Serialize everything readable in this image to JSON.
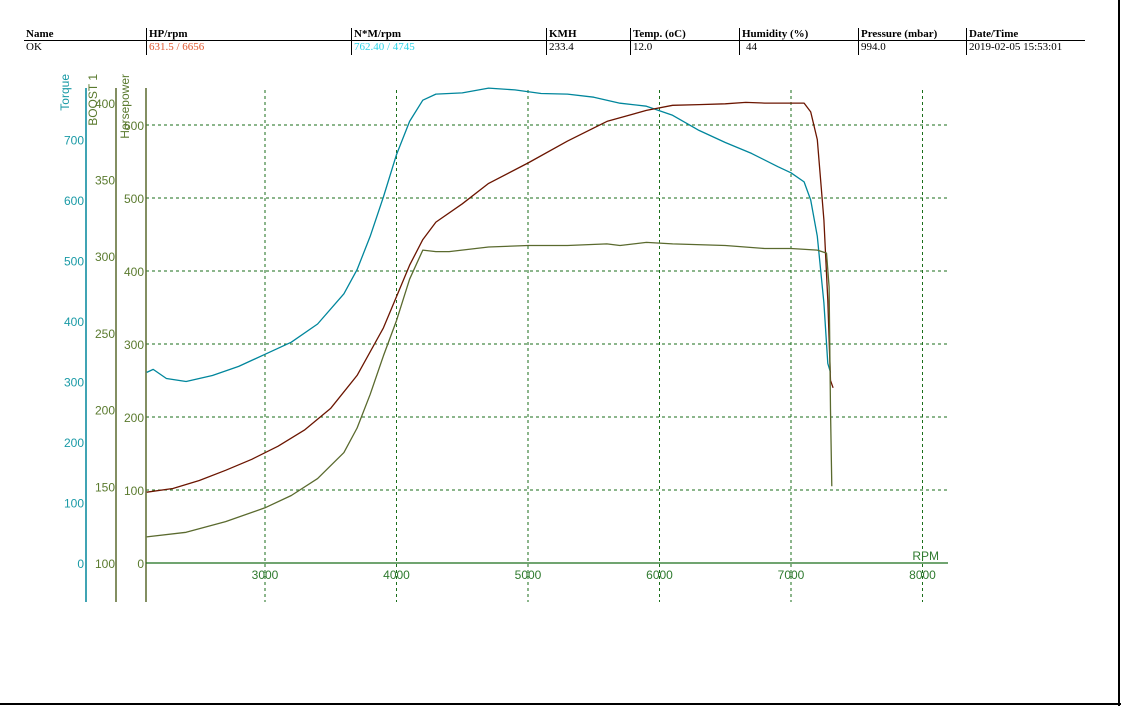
{
  "header": {
    "columns": [
      "Name",
      "HP/rpm",
      "N*M/rpm",
      "KMH",
      "Temp. (oC)",
      "Humidity (%)",
      "Pressure (mbar)",
      "Date/Time"
    ],
    "row": {
      "name": "OK",
      "hp_rpm": "631.5 / 6656",
      "nm_rpm": "762.40 / 4745",
      "kmh": "233.4",
      "temp": "12.0",
      "humidity": "44",
      "pressure": "994.0",
      "datetime": "2019-02-05 15:53:01"
    }
  },
  "colors": {
    "torque": "#00869c",
    "horsepower": "#6b1500",
    "boost": "#5a6a2e",
    "grid": "#1a6e1a",
    "torque_axis_text": "#1a9aa6",
    "boost_axis_text": "#5a7a2e",
    "hp_axis_text": "#5a7a2e",
    "rpm_text": "#2e7a2e"
  },
  "chart_data": {
    "type": "line",
    "xlabel": "RPM",
    "xlim": [
      2100,
      8200
    ],
    "x_ticks": [
      "3000",
      "4000",
      "5000",
      "6000",
      "7000",
      "8000"
    ],
    "axes": {
      "torque": {
        "label": "Torque",
        "ylim": [
          0,
          800
        ],
        "ticks": [
          "0",
          "100",
          "200",
          "300",
          "400",
          "500",
          "600",
          "700"
        ]
      },
      "boost": {
        "label": "BOOST 1",
        "ylim": [
          100,
          400
        ],
        "ticks": [
          "100",
          "150",
          "200",
          "250",
          "300",
          "350",
          "400"
        ]
      },
      "horsepower": {
        "label": "Horsepower",
        "ylim": [
          0,
          650
        ],
        "ticks": [
          "0",
          "100",
          "200",
          "300",
          "400",
          "500",
          "600"
        ]
      }
    },
    "grid": true,
    "series": [
      {
        "key": "torque",
        "axis": "torque",
        "x": [
          2100,
          2150,
          2250,
          2400,
          2600,
          2800,
          3000,
          3200,
          3400,
          3600,
          3700,
          3800,
          3900,
          4000,
          4100,
          4200,
          4300,
          4500,
          4700,
          4900,
          5100,
          5300,
          5500,
          5700,
          5900,
          6100,
          6300,
          6500,
          6700,
          6900,
          7000,
          7100,
          7150,
          7200,
          7250,
          7280,
          7300
        ],
        "y": [
          315,
          320,
          305,
          300,
          310,
          325,
          345,
          365,
          395,
          445,
          485,
          540,
          605,
          675,
          730,
          765,
          775,
          777,
          785,
          782,
          776,
          775,
          770,
          760,
          755,
          740,
          715,
          695,
          677,
          655,
          645,
          630,
          600,
          540,
          430,
          330,
          315
        ]
      },
      {
        "key": "horsepower",
        "axis": "horsepower",
        "x": [
          2100,
          2300,
          2500,
          2700,
          2900,
          3100,
          3300,
          3500,
          3700,
          3900,
          4000,
          4100,
          4200,
          4300,
          4500,
          4700,
          5000,
          5300,
          5600,
          5900,
          6100,
          6300,
          6500,
          6656,
          6800,
          7000,
          7100,
          7150,
          7200,
          7250,
          7280,
          7300,
          7320
        ],
        "y": [
          97,
          102,
          113,
          127,
          142,
          160,
          182,
          212,
          257,
          322,
          365,
          408,
          443,
          467,
          492,
          520,
          548,
          578,
          605,
          620,
          627,
          628,
          629,
          631,
          630,
          630,
          630,
          618,
          580,
          470,
          360,
          250,
          240
        ]
      },
      {
        "key": "boost",
        "axis": "boost",
        "x": [
          2100,
          2400,
          2700,
          3000,
          3200,
          3400,
          3600,
          3700,
          3800,
          3900,
          4000,
          4100,
          4200,
          4300,
          4400,
          4700,
          5000,
          5300,
          5600,
          5700,
          5900,
          6100,
          6500,
          6800,
          7000,
          7200,
          7270,
          7290,
          7300,
          7310
        ],
        "y": [
          117,
          120,
          127,
          136,
          144,
          155,
          172,
          188,
          210,
          235,
          258,
          285,
          304,
          303,
          303,
          306,
          307,
          307,
          308,
          307,
          309,
          308,
          307,
          305,
          305,
          304,
          302,
          280,
          200,
          150
        ]
      }
    ]
  }
}
